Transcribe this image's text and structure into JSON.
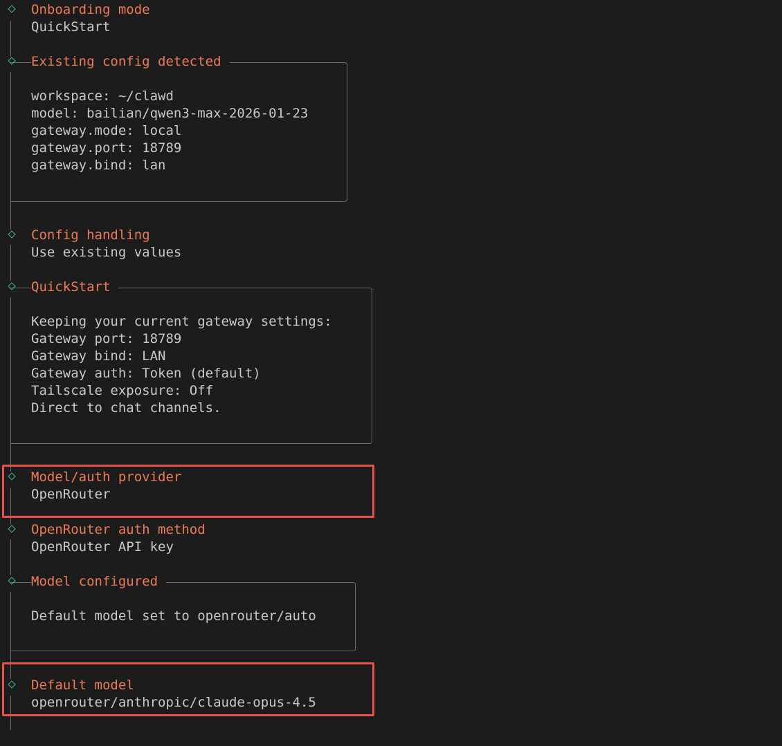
{
  "colors": {
    "background": "#1c1c1c",
    "heading": "#ee7a55",
    "text": "#c8c8c8",
    "diamond": "#3fb8a0",
    "rail": "#6c6c6c",
    "highlight": "#e5534b"
  },
  "steps": {
    "onboarding_mode": {
      "title": "Onboarding mode",
      "value": "QuickStart"
    },
    "existing_config": {
      "title": "Existing config detected",
      "lines": [
        "workspace: ~/clawd",
        "model: bailian/qwen3-max-2026-01-23",
        "gateway.mode: local",
        "gateway.port: 18789",
        "gateway.bind: lan"
      ]
    },
    "config_handling": {
      "title": "Config handling",
      "value": "Use existing values"
    },
    "quickstart": {
      "title": "QuickStart",
      "lines": [
        "Keeping your current gateway settings:",
        "Gateway port: 18789",
        "Gateway bind: LAN",
        "Gateway auth: Token (default)",
        "Tailscale exposure: Off",
        "Direct to chat channels."
      ]
    },
    "model_auth_provider": {
      "title": "Model/auth provider",
      "value": "OpenRouter"
    },
    "openrouter_auth_method": {
      "title": "OpenRouter auth method",
      "value": "OpenRouter API key"
    },
    "model_configured": {
      "title": "Model configured",
      "lines": [
        "Default model set to openrouter/auto"
      ]
    },
    "default_model": {
      "title": "Default model",
      "value": "openrouter/anthropic/claude-opus-4.5"
    }
  }
}
